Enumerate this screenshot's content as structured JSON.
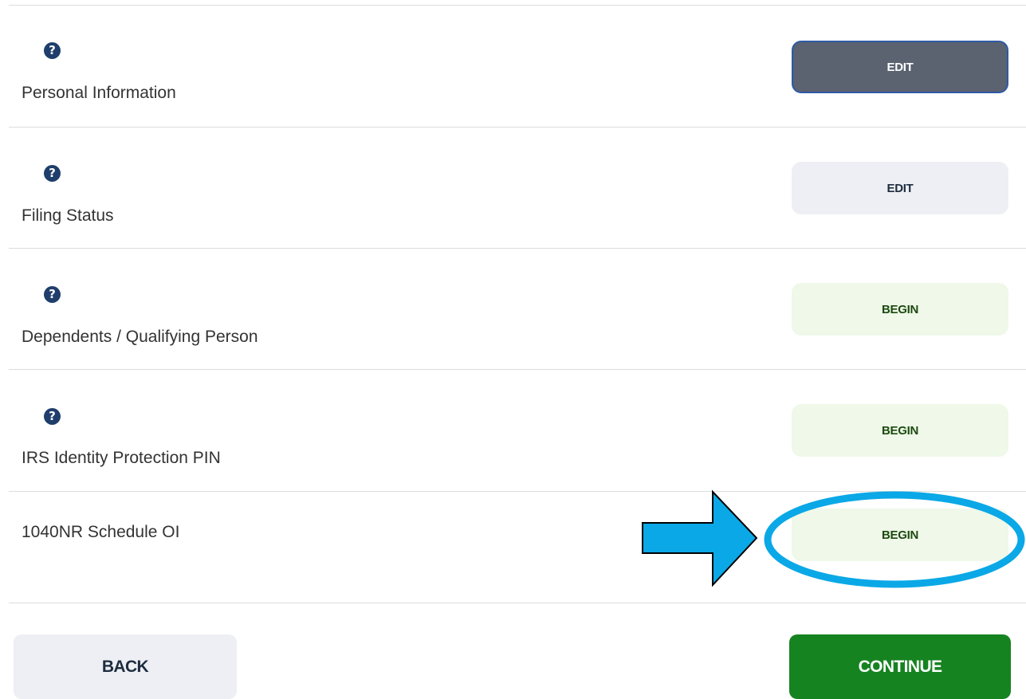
{
  "rows": [
    {
      "label": "Personal Information",
      "help_glyph": "?",
      "button": "EDIT",
      "has_help": true
    },
    {
      "label": "Filing Status",
      "help_glyph": "?",
      "button": "EDIT",
      "has_help": true
    },
    {
      "label": "Dependents / Qualifying Person",
      "help_glyph": "?",
      "button": "BEGIN",
      "has_help": true
    },
    {
      "label": "IRS Identity Protection PIN",
      "help_glyph": "?",
      "button": "BEGIN",
      "has_help": true
    },
    {
      "label": "1040NR Schedule OI",
      "button": "BEGIN",
      "has_help": false
    }
  ],
  "nav": {
    "back_label": "BACK",
    "continue_label": "CONTINUE"
  },
  "colors": {
    "help_icon": "#1f3e6b",
    "active_edit_button": "#5b6270",
    "begin_button": "#eff8e9",
    "continue_button": "#168321",
    "annotation_highlight": "#0aa8e6"
  },
  "icons": {
    "help": "question-circle-icon",
    "annotation": "arrow-right-icon"
  }
}
